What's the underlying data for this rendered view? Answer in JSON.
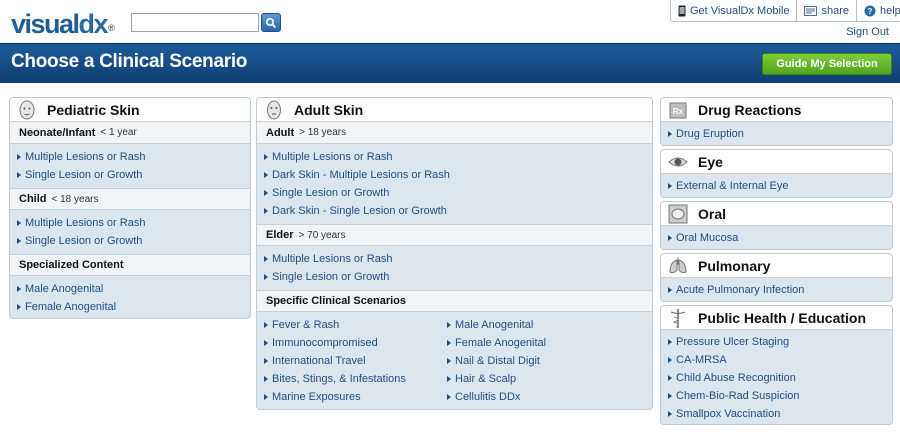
{
  "logo": {
    "visual": "visual",
    "dx": "dx",
    "reg": "®"
  },
  "search": {
    "value": "",
    "placeholder": ""
  },
  "topnav": {
    "mobile": "Get VisualDx Mobile",
    "share": "share",
    "help": "help",
    "signout": "Sign Out"
  },
  "header": {
    "title": "Choose a Clinical Scenario",
    "guide_button": "Guide My Selection"
  },
  "pediatric": {
    "title": "Pediatric Skin",
    "neonate": {
      "label": "Neonate/Infant",
      "age": "< 1 year",
      "links": [
        "Multiple Lesions or Rash",
        "Single Lesion or Growth"
      ]
    },
    "child": {
      "label": "Child",
      "age": "< 18 years",
      "links": [
        "Multiple Lesions or Rash",
        "Single Lesion or Growth"
      ]
    },
    "specialized": {
      "label": "Specialized Content",
      "links": [
        "Male Anogenital",
        "Female Anogenital"
      ]
    }
  },
  "adult": {
    "title": "Adult Skin",
    "adult": {
      "label": "Adult",
      "age": "> 18 years",
      "links": [
        "Multiple Lesions or Rash",
        "Dark Skin - Multiple Lesions or Rash",
        "Single Lesion or Growth",
        "Dark Skin - Single Lesion or Growth"
      ]
    },
    "elder": {
      "label": "Elder",
      "age": "> 70 years",
      "links": [
        "Multiple Lesions or Rash",
        "Single Lesion or Growth"
      ]
    },
    "specific": {
      "label": "Specific Clinical Scenarios",
      "left": [
        "Fever & Rash",
        "Immunocompromised",
        "International Travel",
        "Bites, Stings, & Infestations",
        "Marine Exposures"
      ],
      "right": [
        "Male Anogenital",
        "Female Anogenital",
        "Nail & Distal Digit",
        "Hair & Scalp",
        "Cellulitis DDx"
      ]
    }
  },
  "drug": {
    "title": "Drug Reactions",
    "links": [
      "Drug Eruption"
    ]
  },
  "eye": {
    "title": "Eye",
    "links": [
      "External & Internal Eye"
    ]
  },
  "oral": {
    "title": "Oral",
    "links": [
      "Oral Mucosa"
    ]
  },
  "pulmonary": {
    "title": "Pulmonary",
    "links": [
      "Acute Pulmonary Infection"
    ]
  },
  "publichealth": {
    "title": "Public Health / Education",
    "links": [
      "Pressure Ulcer Staging",
      "CA-MRSA",
      "Child Abuse Recognition",
      "Chem-Bio-Rad Suspicion",
      "Smallpox Vaccination"
    ]
  },
  "colors": {
    "header_blue": "#1d5b98",
    "link_blue": "#1f4f87",
    "button_green": "#5fb02a",
    "panel_bg": "#dce6ee"
  }
}
